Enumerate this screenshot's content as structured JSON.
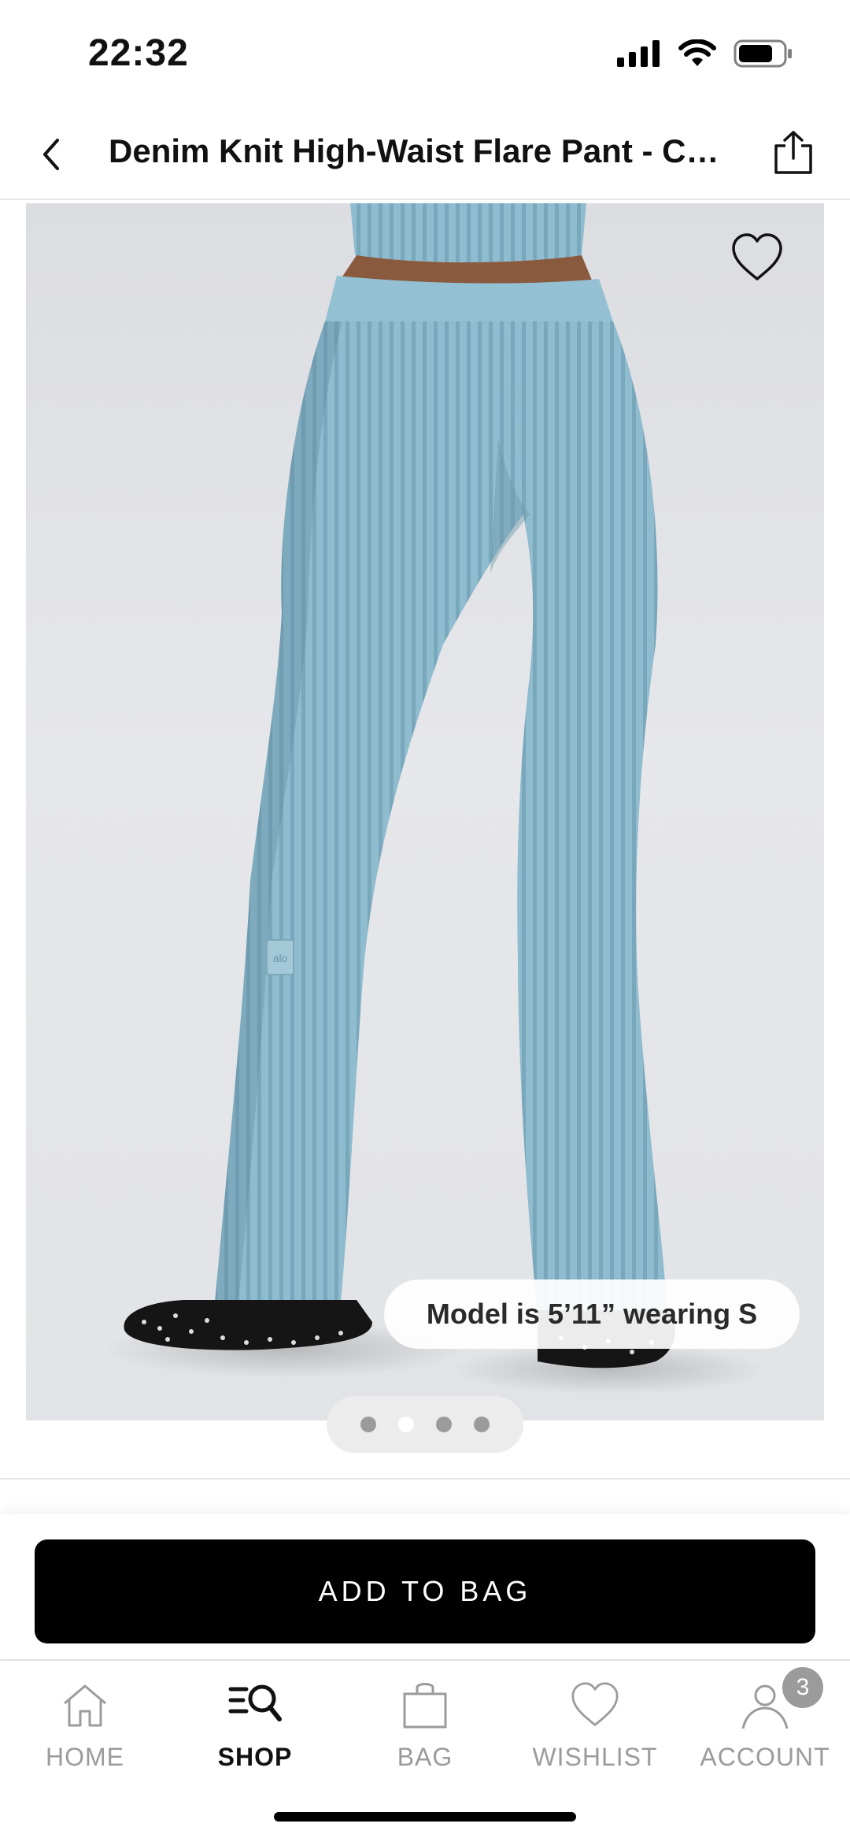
{
  "status_bar": {
    "time": "22:32"
  },
  "header": {
    "title": "Denim Knit High-Waist Flare Pant - Cel..."
  },
  "product": {
    "model_info": "Model is 5’11” wearing S",
    "logo_tag": "alo"
  },
  "pagination": {
    "count": 4,
    "active_index": 1
  },
  "cta": {
    "add_to_bag_label": "ADD TO BAG"
  },
  "tab_bar": {
    "tabs": [
      {
        "label": "HOME",
        "icon": "home-icon",
        "active": false
      },
      {
        "label": "SHOP",
        "icon": "shop-search-icon",
        "active": true
      },
      {
        "label": "BAG",
        "icon": "shopping-bag-icon",
        "active": false
      },
      {
        "label": "WISHLIST",
        "icon": "heart-icon",
        "active": false
      },
      {
        "label": "ACCOUNT",
        "icon": "person-icon",
        "active": false
      }
    ],
    "account_badge": "3"
  },
  "colors": {
    "pant_color": "#8fbccf",
    "active_tab": "#111111",
    "inactive_tab": "#9b9b9b",
    "cta_background": "#000000"
  }
}
